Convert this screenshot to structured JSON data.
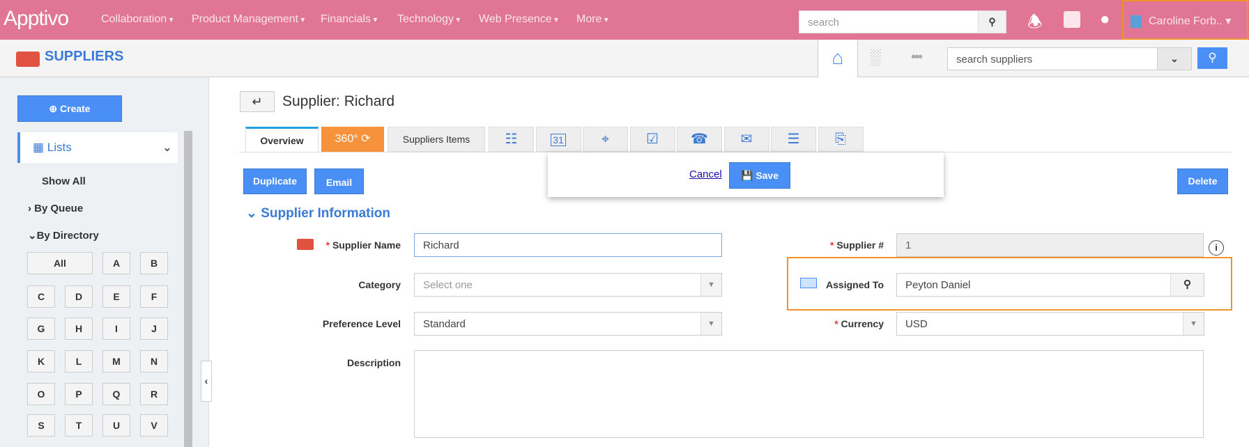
{
  "topbar": {
    "logo": "Apptivo",
    "nav": [
      "Collaboration",
      "Product Management",
      "Financials",
      "Technology",
      "Web Presence",
      "More"
    ],
    "search_placeholder": "search",
    "user": "Caroline Forb.."
  },
  "subbar": {
    "app_title": "SUPPLIERS",
    "search_placeholder": "search suppliers"
  },
  "sidebar": {
    "create": "Create",
    "lists": "Lists",
    "show_all": "Show All",
    "by_queue": "By Queue",
    "by_directory": "By Directory",
    "letters": [
      "All",
      "A",
      "B",
      "C",
      "D",
      "E",
      "F",
      "G",
      "H",
      "I",
      "J",
      "K",
      "L",
      "M",
      "N",
      "O",
      "P",
      "Q",
      "R",
      "S",
      "T",
      "U",
      "V"
    ]
  },
  "main": {
    "title": "Supplier: Richard",
    "tabs": {
      "overview": "Overview",
      "t360": "360°",
      "items": "Suppliers Items"
    },
    "icon_tabs": [
      "form-icon",
      "calendar-icon",
      "pin-icon",
      "task-icon",
      "phone-icon",
      "email-icon",
      "notes-icon",
      "attachment-icon"
    ],
    "calendar_day": "31",
    "actions": {
      "duplicate": "Duplicate",
      "email": "Email",
      "delete": "Delete",
      "cancel": "Cancel",
      "save": "Save"
    },
    "section": "Supplier Information",
    "fields": {
      "supplier_name_label": "Supplier Name",
      "supplier_name": "Richard",
      "category_label": "Category",
      "category_placeholder": "Select one",
      "preference_label": "Preference Level",
      "preference": "Standard",
      "description_label": "Description",
      "supplier_no_label": "Supplier #",
      "supplier_no": "1",
      "assigned_label": "Assigned To",
      "assigned": "Peyton Daniel",
      "currency_label": "Currency",
      "currency": "USD"
    }
  },
  "colors": {
    "topbar": "#e07595",
    "accent": "#4a8ff5",
    "tab360": "#f7923c",
    "highlight": "#f0932b"
  }
}
